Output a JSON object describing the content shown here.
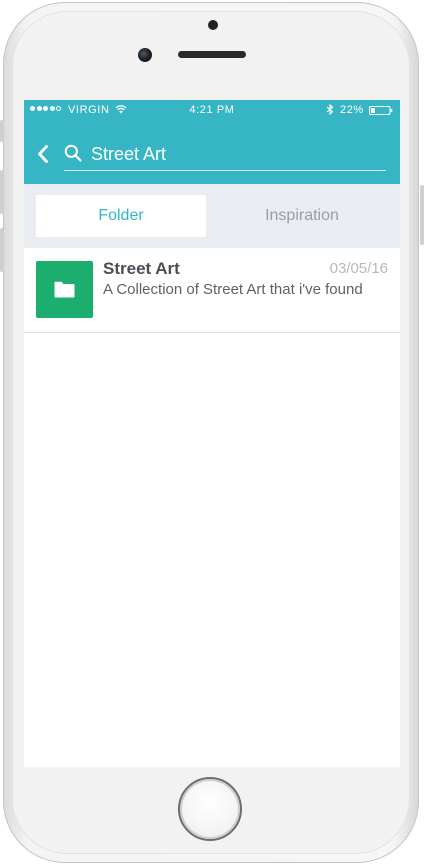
{
  "status_bar": {
    "carrier": "VIRGIN",
    "time": "4:21 PM",
    "battery_percent": "22%",
    "battery_level": 0.22,
    "signal_bars_filled": 4,
    "signal_bars_total": 5
  },
  "header": {
    "back_icon": "chevron-left-icon",
    "search_icon": "search-icon",
    "search_value": "Street Art",
    "accent_color": "#36b6c4"
  },
  "tabs": [
    {
      "label": "Folder",
      "active": true
    },
    {
      "label": "Inspiration",
      "active": false
    }
  ],
  "results": [
    {
      "title": "Street Art",
      "description": "A Collection of Street Art that i've found",
      "date": "03/05/16",
      "icon": "folder-icon",
      "thumb_color": "#1bae6e"
    }
  ]
}
